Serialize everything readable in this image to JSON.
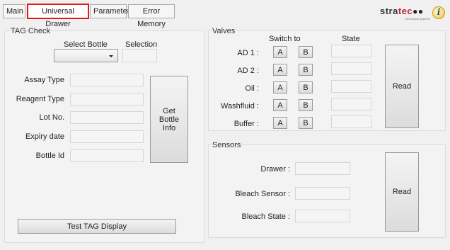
{
  "tabs": [
    {
      "label": "Main"
    },
    {
      "label": "Universal Drawer"
    },
    {
      "label": "Parameter"
    },
    {
      "label": "Error Memory"
    }
  ],
  "logo": {
    "text_primary": "stra",
    "text_accent": "tec",
    "tagline": "biomedical systems"
  },
  "tag_check": {
    "title": "TAG Check",
    "select_bottle_label": "Select Bottle",
    "selection_label": "Selection",
    "fields": [
      {
        "label": "Assay Type",
        "value": ""
      },
      {
        "label": "Reagent Type",
        "value": ""
      },
      {
        "label": "Lot No.",
        "value": ""
      },
      {
        "label": "Expiry date",
        "value": ""
      },
      {
        "label": "Bottle Id",
        "value": ""
      }
    ],
    "get_bottle_info_button": "Get Bottle Info",
    "test_tag_display_button": "Test TAG Display"
  },
  "valves": {
    "title": "Valves",
    "switch_to_label": "Switch to",
    "state_label": "State",
    "rows": [
      {
        "label": "AD 1",
        "a": "A",
        "b": "B",
        "state": ""
      },
      {
        "label": "AD 2",
        "a": "A",
        "b": "B",
        "state": ""
      },
      {
        "label": "Oil",
        "a": "A",
        "b": "B",
        "state": ""
      },
      {
        "label": "Washfluid",
        "a": "A",
        "b": "B",
        "state": ""
      },
      {
        "label": "Buffer",
        "a": "A",
        "b": "B",
        "state": ""
      }
    ],
    "read_button": "Read"
  },
  "sensors": {
    "title": "Sensors",
    "rows": [
      {
        "label": "Drawer",
        "value": ""
      },
      {
        "label": "Bleach Sensor",
        "value": ""
      },
      {
        "label": "Bleach State",
        "value": ""
      }
    ],
    "read_button": "Read"
  },
  "colors": {
    "active_tab_outline": "#e0191e",
    "logo_accent": "#c0282d",
    "background": "#f0f0f0"
  }
}
